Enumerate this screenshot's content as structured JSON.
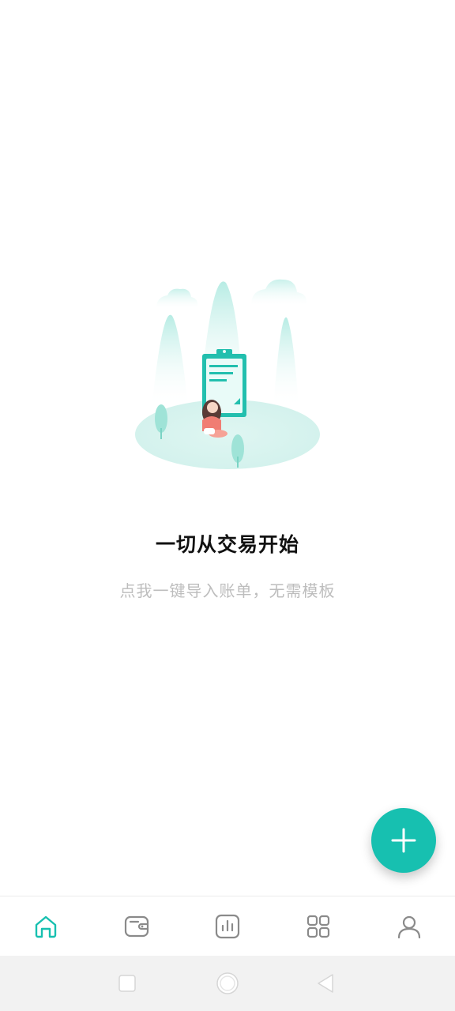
{
  "empty_state": {
    "title": "一切从交易开始",
    "subtitle": "点我一键导入账单，无需模板"
  },
  "fab": {
    "icon": "plus-icon",
    "color": "#17c0b0"
  },
  "bottom_nav": {
    "items": [
      {
        "name": "home",
        "icon": "home-icon",
        "active": true
      },
      {
        "name": "wallet",
        "icon": "wallet-icon",
        "active": false
      },
      {
        "name": "stats",
        "icon": "bar-chart-icon",
        "active": false
      },
      {
        "name": "apps",
        "icon": "grid-icon",
        "active": false
      },
      {
        "name": "profile",
        "icon": "user-icon",
        "active": false
      }
    ],
    "active_color": "#17c0b0",
    "inactive_color": "#8a8a8a"
  },
  "system_nav": {
    "buttons": [
      "recents-icon",
      "home-circle-icon",
      "back-icon"
    ]
  }
}
